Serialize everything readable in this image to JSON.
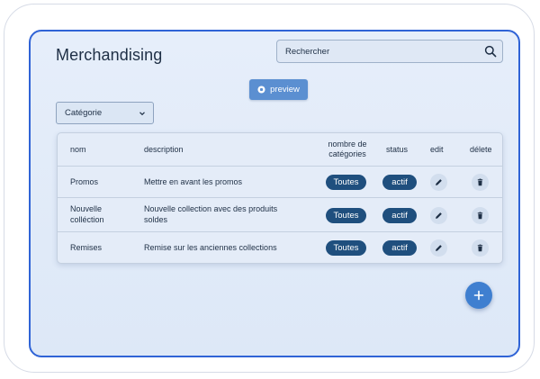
{
  "page": {
    "title": "Merchandising"
  },
  "search": {
    "placeholder": "Rechercher",
    "icon": "search-icon"
  },
  "toolbar": {
    "preview_label": "preview",
    "preview_icon": "eye-icon"
  },
  "filter": {
    "category_label": "Catégorie",
    "icon": "chevron-down-icon"
  },
  "table": {
    "columns": {
      "nom": "nom",
      "description": "description",
      "categories_line1": "nombre de",
      "categories_line2": "catégories",
      "status": "status",
      "edit": "edit",
      "delete": "délete"
    },
    "rows": [
      {
        "nom_line1": "Promos",
        "nom_line2": "",
        "desc_line1": "Mettre en avant les promos",
        "desc_line2": "",
        "categories": "Toutes",
        "status": "actif"
      },
      {
        "nom_line1": "Nouvelle",
        "nom_line2": "colléction",
        "desc_line1": "Nouvelle collection avec des produits",
        "desc_line2": "soldes",
        "categories": "Toutes",
        "status": "actif"
      },
      {
        "nom_line1": "Remises",
        "nom_line2": "",
        "desc_line1": "Remise sur les anciennes collections",
        "desc_line2": "",
        "categories": "Toutes",
        "status": "actif"
      }
    ]
  },
  "fab": {
    "icon": "plus-icon"
  },
  "colors": {
    "accent": "#2f63d6",
    "pill": "#1f4f7e",
    "fab": "#3f7fd0",
    "preview": "#5b8fd1"
  }
}
